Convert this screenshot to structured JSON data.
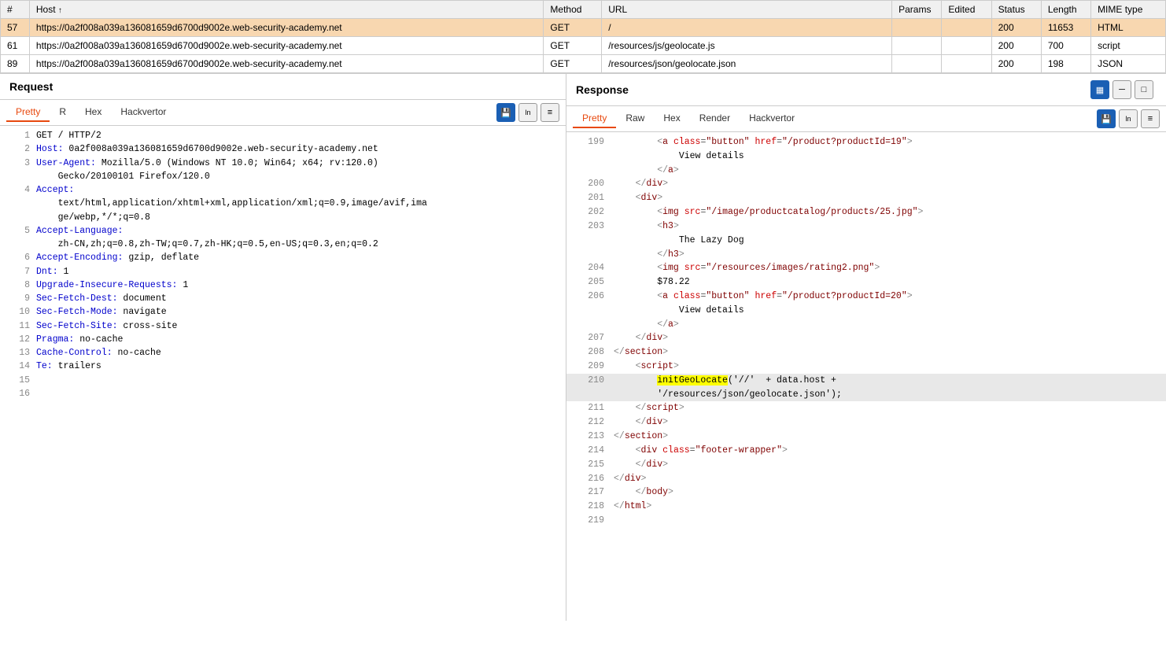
{
  "table": {
    "columns": [
      "#",
      "Host",
      "Method",
      "URL",
      "Params",
      "Edited",
      "Status",
      "Length",
      "MIME type"
    ],
    "rows": [
      {
        "num": "57",
        "host": "https://0a2f008a039a136081659d6700d9002e.web-security-academy.net",
        "method": "GET",
        "url": "/",
        "params": "",
        "edited": "",
        "status": "200",
        "length": "11653",
        "mime": "HTML",
        "selected": true
      },
      {
        "num": "61",
        "host": "https://0a2f008a039a136081659d6700d9002e.web-security-academy.net",
        "method": "GET",
        "url": "/resources/js/geolocate.js",
        "params": "",
        "edited": "",
        "status": "200",
        "length": "700",
        "mime": "script",
        "selected": false
      },
      {
        "num": "89",
        "host": "https://0a2f008a039a136081659d6700d9002e.web-security-academy.net",
        "method": "GET",
        "url": "/resources/json/geolocate.json",
        "params": "",
        "edited": "",
        "status": "200",
        "length": "198",
        "mime": "JSON",
        "selected": false
      }
    ]
  },
  "request": {
    "title": "Request",
    "tabs": [
      "Pretty",
      "R",
      "Hex",
      "Hackvertor"
    ],
    "active_tab": "Pretty",
    "lines": [
      "1 GET / HTTP/2",
      "2 Host: 0a2f008a039a136081659d6700d9002e.web-security-academy.net",
      "3 User-Agent: Mozilla/5.0 (Windows NT 10.0; Win64; x64; rv:120.0)",
      "  Gecko/20100101 Firefox/120.0",
      "4 Accept:",
      "  text/html,application/xhtml+xml,application/xml;q=0.9,image/avif,ima",
      "  ge/webp,*/*;q=0.8",
      "5 Accept-Language:",
      "  zh-CN,zh;q=0.8,zh-TW;q=0.7,zh-HK;q=0.5,en-US;q=0.3,en;q=0.2",
      "6 Accept-Encoding: gzip, deflate",
      "7 Dnt: 1",
      "8 Upgrade-Insecure-Requests: 1",
      "9 Sec-Fetch-Dest: document",
      "10 Sec-Fetch-Mode: navigate",
      "11 Sec-Fetch-Site: cross-site",
      "12 Pragma: no-cache",
      "13 Cache-Control: no-cache",
      "14 Te: trailers",
      "15",
      "16"
    ]
  },
  "response": {
    "title": "Response",
    "tabs": [
      "Pretty",
      "Raw",
      "Hex",
      "Render",
      "Hackvertor"
    ],
    "active_tab": "Pretty"
  },
  "icons": {
    "grid": "▦",
    "minus": "─",
    "square": "□",
    "ln": "ln",
    "menu": "≡",
    "save": "💾"
  }
}
